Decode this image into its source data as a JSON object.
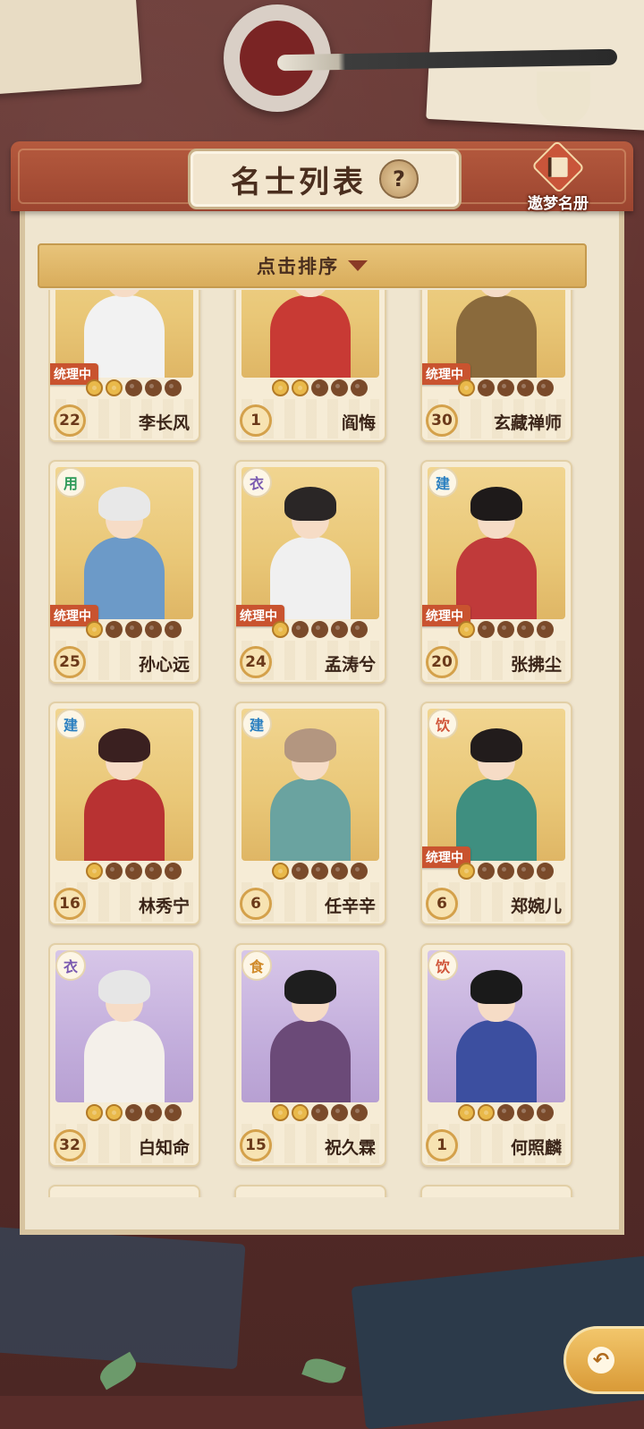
{
  "header": {
    "title": "名士列表",
    "help_icon": "?",
    "dream_book_label": "遨梦名册"
  },
  "sort": {
    "label": "点击排序"
  },
  "cards": [
    {
      "name": "李长风",
      "level": "22",
      "role": "",
      "managing": "统理中",
      "stars": 2,
      "bg": "gold"
    },
    {
      "name": "阎悔",
      "level": "1",
      "role": "",
      "managing": "",
      "stars": 2,
      "bg": "gold"
    },
    {
      "name": "玄藏禅师",
      "level": "30",
      "role": "",
      "managing": "统理中",
      "stars": 1,
      "bg": "gold"
    },
    {
      "name": "孙心远",
      "level": "25",
      "role": "用",
      "managing": "统理中",
      "stars": 1,
      "bg": "gold"
    },
    {
      "name": "孟涛兮",
      "level": "24",
      "role": "衣",
      "managing": "统理中",
      "stars": 1,
      "bg": "gold"
    },
    {
      "name": "张拂尘",
      "level": "20",
      "role": "建",
      "managing": "统理中",
      "stars": 1,
      "bg": "gold"
    },
    {
      "name": "林秀宁",
      "level": "16",
      "role": "建",
      "managing": "",
      "stars": 1,
      "bg": "gold"
    },
    {
      "name": "任辛辛",
      "level": "6",
      "role": "建",
      "managing": "",
      "stars": 1,
      "bg": "gold"
    },
    {
      "name": "郑婉儿",
      "level": "6",
      "role": "饮",
      "managing": "统理中",
      "stars": 1,
      "bg": "gold"
    },
    {
      "name": "白知命",
      "level": "32",
      "role": "衣",
      "managing": "",
      "stars": 2,
      "bg": "purple"
    },
    {
      "name": "祝久霖",
      "level": "15",
      "role": "食",
      "managing": "",
      "stars": 2,
      "bg": "purple"
    },
    {
      "name": "何照麟",
      "level": "1",
      "role": "饮",
      "managing": "",
      "stars": 2,
      "bg": "purple"
    }
  ],
  "colors": {
    "role_用": "#2f9a58",
    "role_衣": "#7a5ab0",
    "role_建": "#2a7fc0",
    "role_饮": "#d0553a",
    "role_食": "#d08a2a"
  },
  "back_button": {
    "icon": "back-arrow-icon",
    "glyph": "↶"
  }
}
